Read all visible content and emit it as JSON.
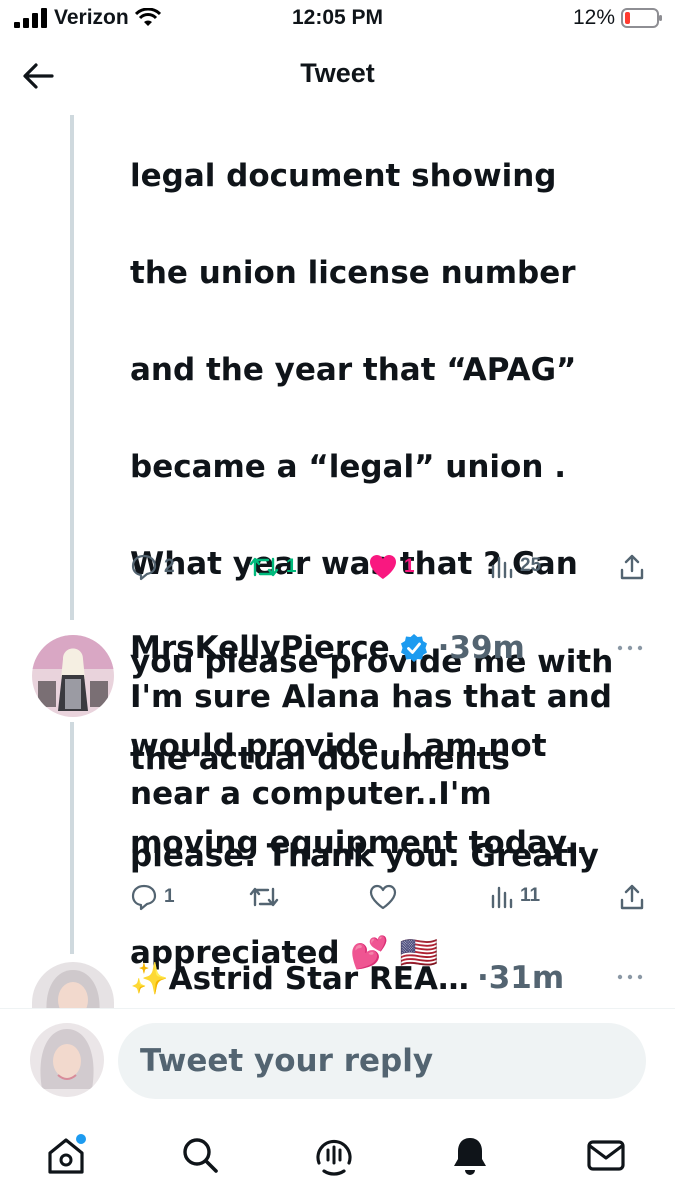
{
  "status_bar": {
    "carrier": "Verizon",
    "time": "12:05 PM",
    "battery": "12%"
  },
  "header": {
    "title": "Tweet"
  },
  "main_tweet": {
    "text_lines": [
      "legal document showing",
      "the union license number",
      "and the year that “APAG”",
      "became a “legal” union .",
      "What year was that ? Can",
      "you please provide me with",
      "the actual documents",
      "please. Thank you. Greatly",
      "appreciated 💕 🇺🇸"
    ],
    "replies": "2",
    "retweets": "1",
    "likes": "1",
    "views": "25"
  },
  "reply_tweet": {
    "name": "MrsKellyPierce",
    "time": "·39m",
    "text": "I'm sure Alana has that and\nwould provide..I am not\nnear a computer..I'm\nmoving equipment today..",
    "replies": "1",
    "views": "11"
  },
  "next_tweet": {
    "name": "✨Astrid Star REA…",
    "time": "·31m"
  },
  "reply_bar": {
    "placeholder": "Tweet your reply"
  },
  "colors": {
    "retweet": "#00ba7c",
    "like": "#f91880",
    "verified": "#1d9bf0",
    "muted": "#536471"
  },
  "icons": [
    "back-arrow-icon",
    "reply-icon",
    "retweet-icon",
    "heart-icon",
    "views-icon",
    "share-icon",
    "verified-badge-icon",
    "home-icon",
    "search-icon",
    "spaces-icon",
    "notifications-icon",
    "messages-icon"
  ]
}
